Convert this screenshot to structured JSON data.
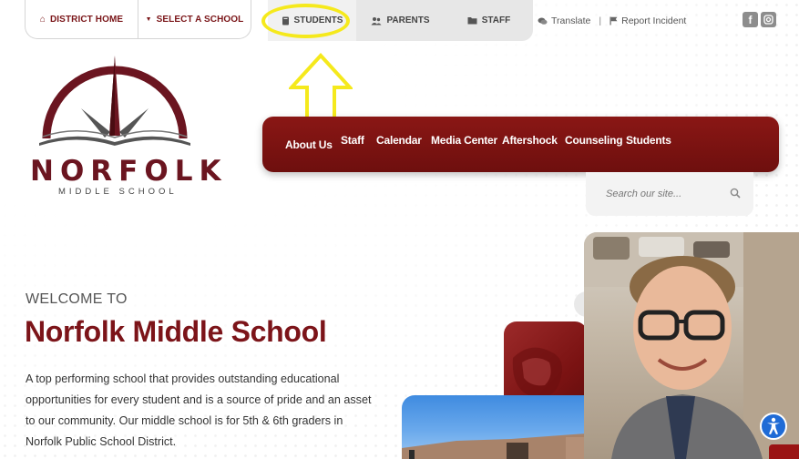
{
  "topbar": {
    "district_home": "DISTRICT HOME",
    "select_school": "SELECT A SCHOOL",
    "tabs": [
      {
        "label": "STUDENTS",
        "icon": "book-icon"
      },
      {
        "label": "PARENTS",
        "icon": "people-icon"
      },
      {
        "label": "STAFF",
        "icon": "folder-icon"
      }
    ],
    "translate": "Translate",
    "report_incident": "Report Incident",
    "social": [
      "facebook-icon",
      "instagram-icon"
    ]
  },
  "logo": {
    "word": "NORFOLK",
    "sub": "MIDDLE SCHOOL"
  },
  "nav": {
    "items": [
      "About Us",
      "Staff",
      "Calendar",
      "Media Center",
      "Aftershock",
      "Counseling",
      "Students"
    ]
  },
  "search": {
    "placeholder": "Search our site..."
  },
  "hero": {
    "welcome": "WELCOME TO",
    "title": "Norfolk Middle School",
    "description": "A top performing school that provides outstanding educational opportunities for every student and is a source of pride and an asset to our community. Our middle school is for 5th & 6th graders in Norfolk Public School District."
  },
  "colors": {
    "brand": "#7c1419",
    "nav_bg": "#7a1312",
    "highlight": "#f5e91c",
    "accessibility": "#1f6bd6"
  }
}
